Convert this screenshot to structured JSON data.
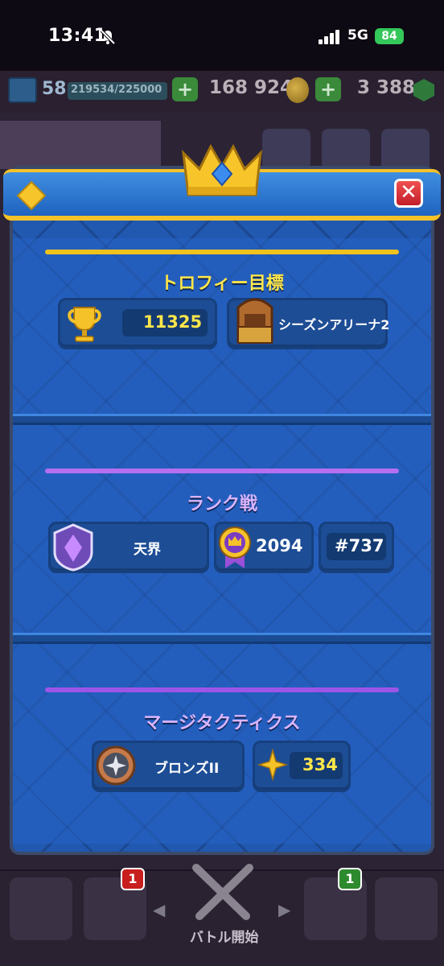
{
  "status_bar": {
    "time": "13:41",
    "network": "5G",
    "battery": "84"
  },
  "top_bar": {
    "level": "58",
    "xp": "219534/225000",
    "gold": "168 924",
    "gems": "3 388",
    "plus_symbol": "+"
  },
  "modal": {
    "close_symbol": "✕",
    "trophy_section": {
      "title": "トロフィー目標",
      "trophies": "11325",
      "arena": "シーズンアリーナ2"
    },
    "ranked_section": {
      "title": "ランク戦",
      "league": "天界",
      "rating": "2094",
      "rank": "#737"
    },
    "merge_section": {
      "title": "マージタクティクス",
      "league": "ブロンズII",
      "points": "334"
    }
  },
  "bottom_nav": {
    "cards_badge": "1",
    "clan_badge": "1",
    "battle_label": "バトル開始",
    "arrow_left": "◀",
    "arrow_right": "▶"
  },
  "colors": {
    "modal_blue": "#2158b0",
    "header_gold": "#f5c229",
    "trophy_line": "#f0c21c",
    "ranked_line": "#b56ff0",
    "value_yellow": "#ffe64a"
  }
}
